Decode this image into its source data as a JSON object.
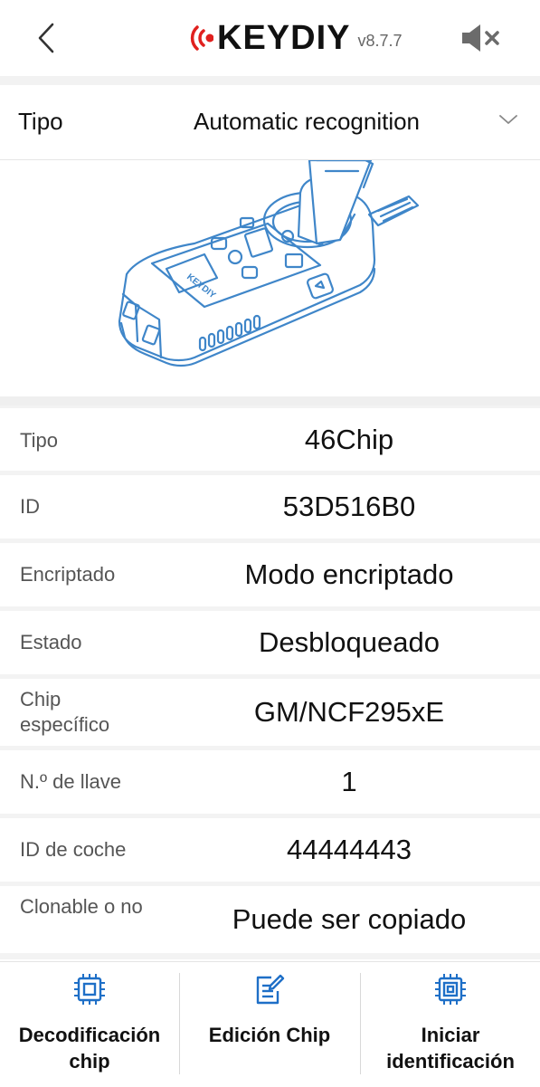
{
  "header": {
    "back_icon": "chevron-left-icon",
    "logo_text": "KEYDIY",
    "version": "v8.7.7",
    "sound_icon": "volume-mute-icon"
  },
  "type_selector": {
    "label": "Tipo",
    "value": "Automatic recognition",
    "icon": "chevron-down-icon"
  },
  "device_image": {
    "brand_text": "KEYDIY"
  },
  "info": [
    {
      "label": "Tipo",
      "value": "46Chip"
    },
    {
      "label": "ID",
      "value": "53D516B0"
    },
    {
      "label": "Encriptado",
      "value": "Modo encriptado"
    },
    {
      "label": "Estado",
      "value": "Desbloqueado"
    },
    {
      "label": "Chip específico",
      "value": "GM/NCF295xE"
    },
    {
      "label": "N.º de llave",
      "value": "1"
    },
    {
      "label": "ID de coche",
      "value": "44444443"
    },
    {
      "label": "Clonable o no",
      "value": "Puede ser copiado"
    }
  ],
  "actions": [
    {
      "label": "Decodificación chip",
      "icon": "chip-decode-icon"
    },
    {
      "label": "Edición Chip",
      "icon": "edit-document-icon"
    },
    {
      "label": "Iniciar identificación",
      "icon": "chip-identify-icon"
    }
  ],
  "colors": {
    "accent_blue": "#1e6fc7",
    "logo_red": "#e0201e",
    "text": "#111111",
    "label_gray": "#555555"
  }
}
